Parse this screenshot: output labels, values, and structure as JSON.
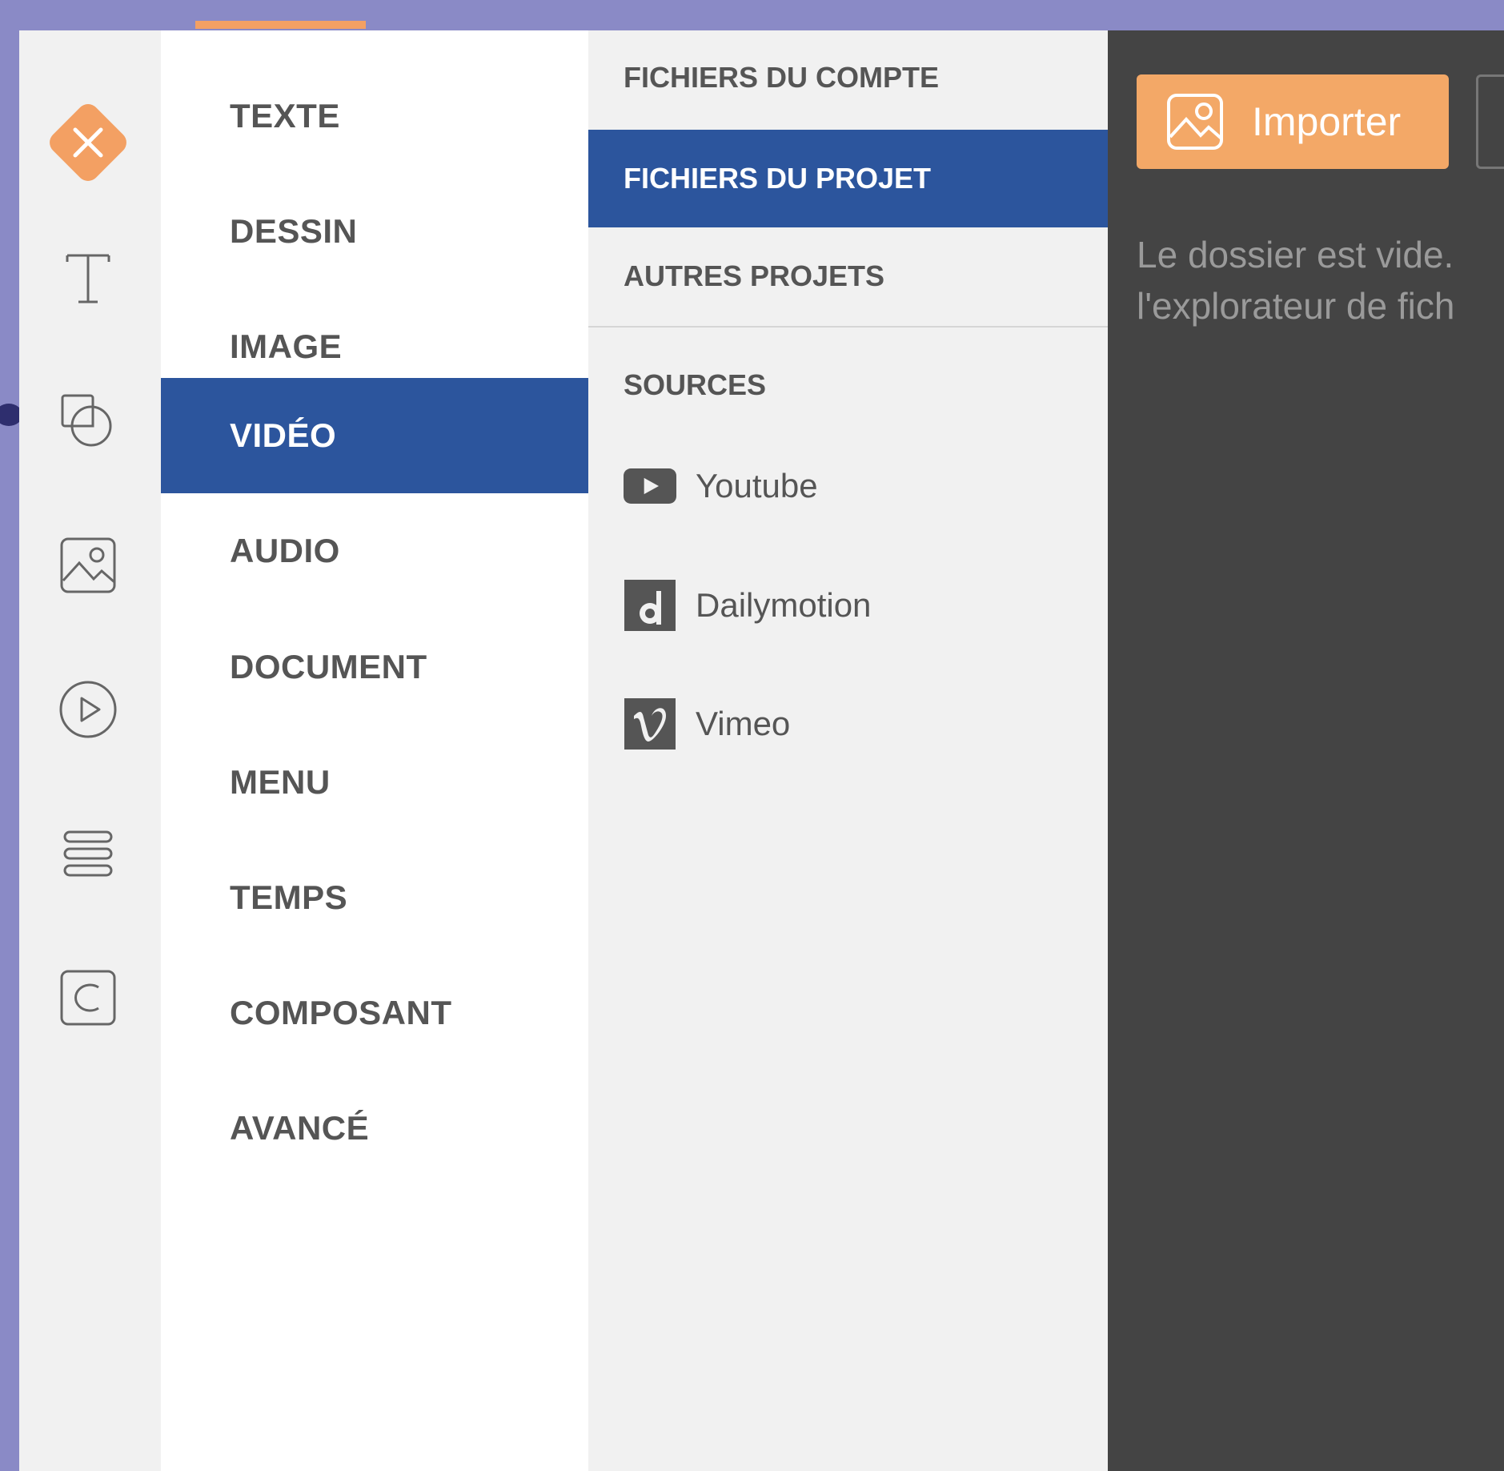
{
  "colors": {
    "accent_orange": "#f3a063",
    "active_blue": "#2c559d",
    "dark_panel": "#444444",
    "background_purple": "#8a8ac6"
  },
  "rail": {
    "icons": [
      "close-icon",
      "text-icon",
      "shapes-icon",
      "image-icon",
      "play-icon",
      "menu-icon",
      "component-icon"
    ]
  },
  "categories": [
    {
      "label": "TEXTE",
      "active": false
    },
    {
      "label": "DESSIN",
      "active": false
    },
    {
      "label": "IMAGE",
      "active": false
    },
    {
      "label": "VIDÉO",
      "active": true
    },
    {
      "label": "AUDIO",
      "active": false
    },
    {
      "label": "DOCUMENT",
      "active": false
    },
    {
      "label": "MENU",
      "active": false
    },
    {
      "label": "TEMPS",
      "active": false
    },
    {
      "label": "COMPOSANT",
      "active": false
    },
    {
      "label": "AVANCÉ",
      "active": false
    }
  ],
  "sub": {
    "items": [
      {
        "label": "FICHIERS DU COMPTE",
        "active": false
      },
      {
        "label": "FICHIERS DU PROJET",
        "active": true
      },
      {
        "label": "AUTRES PROJETS",
        "active": false
      }
    ],
    "sources_heading": "SOURCES",
    "sources": [
      {
        "label": "Youtube",
        "icon": "youtube-icon"
      },
      {
        "label": "Dailymotion",
        "icon": "dailymotion-icon"
      },
      {
        "label": "Vimeo",
        "icon": "vimeo-icon"
      }
    ]
  },
  "panel": {
    "import_label": "Importer",
    "empty_line1": "Le dossier est vide.",
    "empty_line2": "l'explorateur de fich"
  }
}
